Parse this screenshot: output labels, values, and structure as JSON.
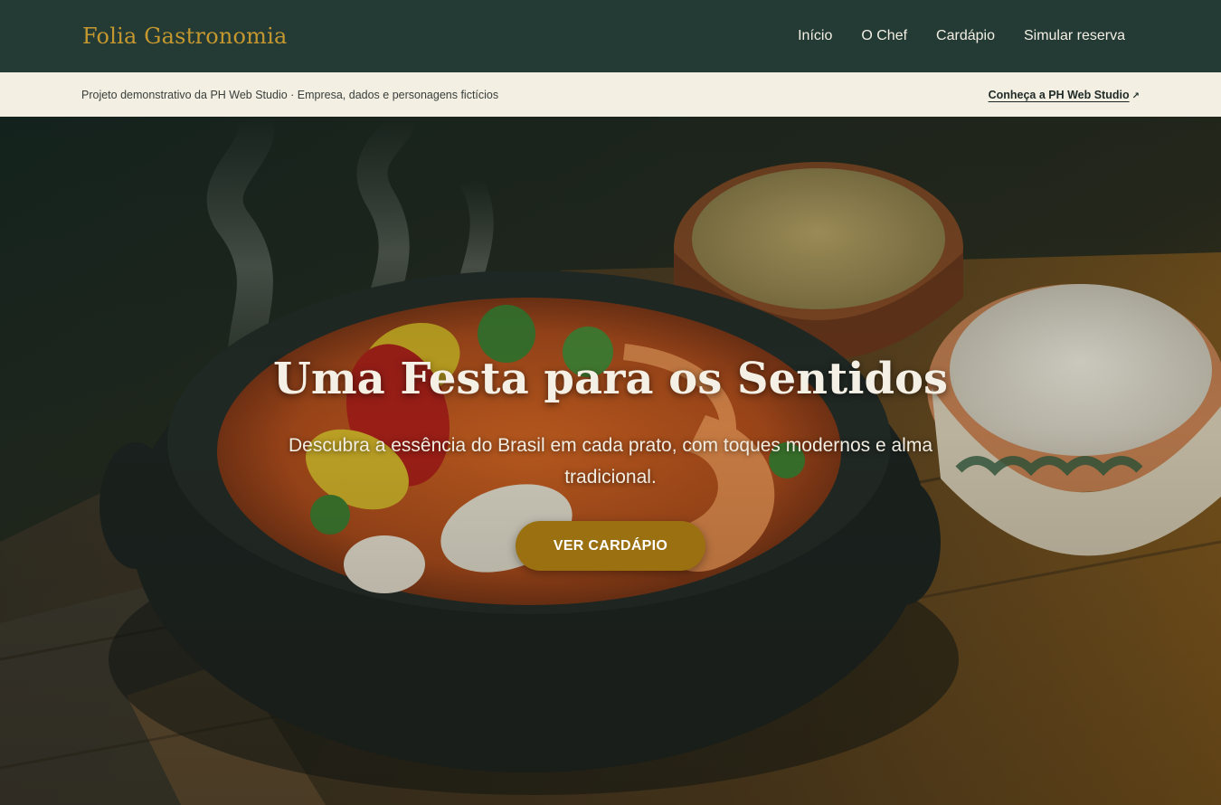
{
  "header": {
    "brand": "Folia Gastronomia",
    "nav": [
      "Início",
      "O Chef",
      "Cardápio",
      "Simular reserva"
    ]
  },
  "banner": {
    "text": "Projeto demonstrativo da PH Web Studio · Empresa, dados e personagens fictícios",
    "link_label": "Conheça a PH Web Studio",
    "link_icon": "↗"
  },
  "hero": {
    "title": "Uma Festa para os Sentidos",
    "subtitle": "Descubra a essência do Brasil em cada prato, com toques modernos e alma tradicional.",
    "cta_label": "VER CARDÁPIO",
    "image_icon": "moqueca-clay-pot-photo"
  },
  "colors": {
    "nav_bg": "#243a34",
    "brand": "#c4982f",
    "banner_bg": "#f3efe3",
    "cta": "#9a7011"
  }
}
